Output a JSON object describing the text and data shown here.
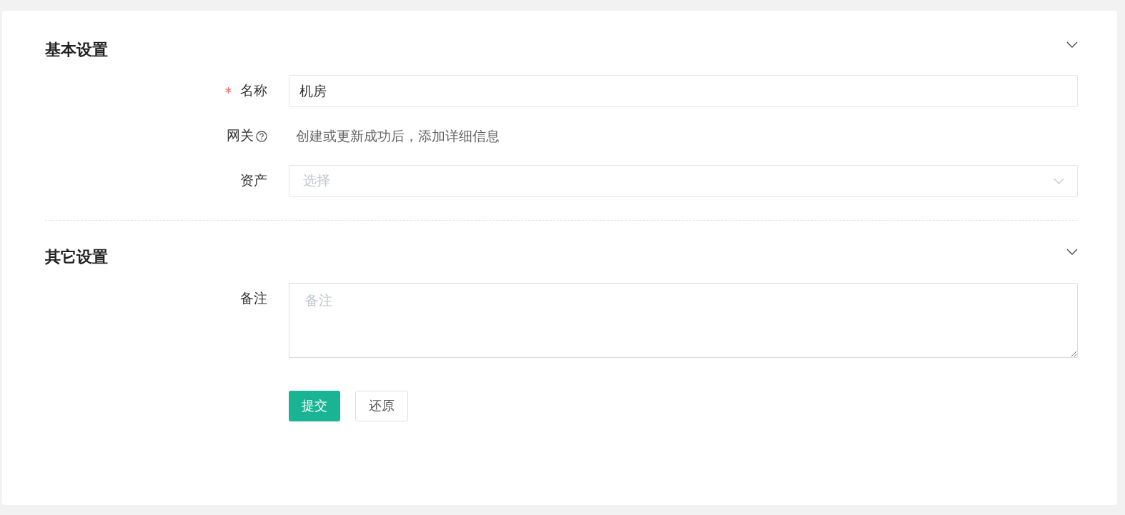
{
  "sections": [
    {
      "title": "基本设置",
      "expanded": true,
      "fields": [
        {
          "kind": "input",
          "label": "名称",
          "required": true,
          "help": false,
          "value": "机房"
        },
        {
          "kind": "text",
          "label": "网关",
          "required": false,
          "help": true,
          "text": "创建或更新成功后，添加详细信息"
        },
        {
          "kind": "select",
          "label": "资产",
          "required": false,
          "help": false,
          "placeholder": "选择"
        }
      ]
    },
    {
      "title": "其它设置",
      "expanded": true,
      "fields": [
        {
          "kind": "textarea",
          "label": "备注",
          "required": false,
          "help": false,
          "placeholder": "备注"
        }
      ]
    }
  ],
  "buttons": [
    {
      "kind": "primary",
      "label": "提交"
    },
    {
      "kind": "default",
      "label": "还原"
    }
  ]
}
